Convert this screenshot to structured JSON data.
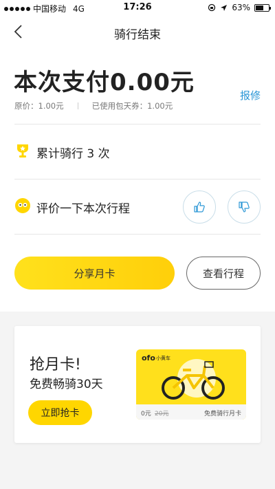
{
  "status_bar": {
    "carrier": "中国移动",
    "network": "4G",
    "time": "17:26",
    "battery": "63%",
    "battery_level": 0.63
  },
  "nav": {
    "title": "骑行结束",
    "back_icon": "chevron-left-icon"
  },
  "summary": {
    "payment": "本次支付0.00元",
    "repair_link": "报修",
    "original_price": "原价：1.00元",
    "pass_used": "已使用包天券：1.00元",
    "ride_count": "累计骑行 3 次",
    "rate_prompt": "评价一下本次行程",
    "thumbs_up_icon": "thumbs-up-icon",
    "thumbs_down_icon": "thumbs-down-icon",
    "share_button": "分享月卡",
    "view_trip_button": "查看行程"
  },
  "promo": {
    "title": "抢月卡!",
    "subtitle": "免费畅骑30天",
    "button": "立即抢卡",
    "card_logo": "ofo",
    "card_logo_sub": "小黄车",
    "card_price": "0元",
    "card_old_price": "20元",
    "card_caption": "免费骑行月卡"
  },
  "colors": {
    "accent_yellow": "#ffd600",
    "link_blue": "#2b97d6"
  }
}
